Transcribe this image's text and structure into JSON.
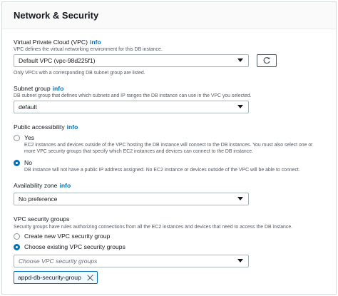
{
  "section": {
    "title": "Network & Security"
  },
  "vpc": {
    "label": "Virtual Private Cloud (VPC)",
    "info": "info",
    "description": "VPC defines the virtual networking environment for this DB instance.",
    "value": "Default VPC (vpc-98d225f1)",
    "hint": "Only VPCs with a corresponding DB subnet group are listed."
  },
  "subnet": {
    "label": "Subnet group",
    "info": "info",
    "description": "DB subnet group that defines which subnets and IP ranges the DB instance can use in the VPC you selected.",
    "value": "default"
  },
  "public_access": {
    "label": "Public accessibility",
    "info": "info",
    "options": [
      {
        "label": "Yes",
        "checked": false,
        "description": "EC2 instances and devices outside of the VPC hosting the DB instance will connect to the DB instances. You must also select one or more VPC security groups that specify which EC2 instances and devices can connect to the DB instance."
      },
      {
        "label": "No",
        "checked": true,
        "description": "DB instance will not have a public IP address assigned. No EC2 instance or devices outside of the VPC will be able to connect."
      }
    ]
  },
  "availability_zone": {
    "label": "Availability zone",
    "info": "info",
    "value": "No preference"
  },
  "security_groups": {
    "label": "VPC security groups",
    "description": "Security groups have rules authorizing connections from all the EC2 instances and devices that need to access the DB instance.",
    "options": [
      {
        "label": "Create new VPC security group",
        "checked": false
      },
      {
        "label": "Choose existing VPC security groups",
        "checked": true
      }
    ],
    "placeholder": "Choose VPC security groups",
    "selected_tag": "appd-db-security-group"
  },
  "colors": {
    "link": "#0073bb",
    "border": "#aab7b8",
    "selected": "#0073bb"
  },
  "icons": [
    "refresh-icon",
    "caret-down-icon",
    "close-icon"
  ]
}
